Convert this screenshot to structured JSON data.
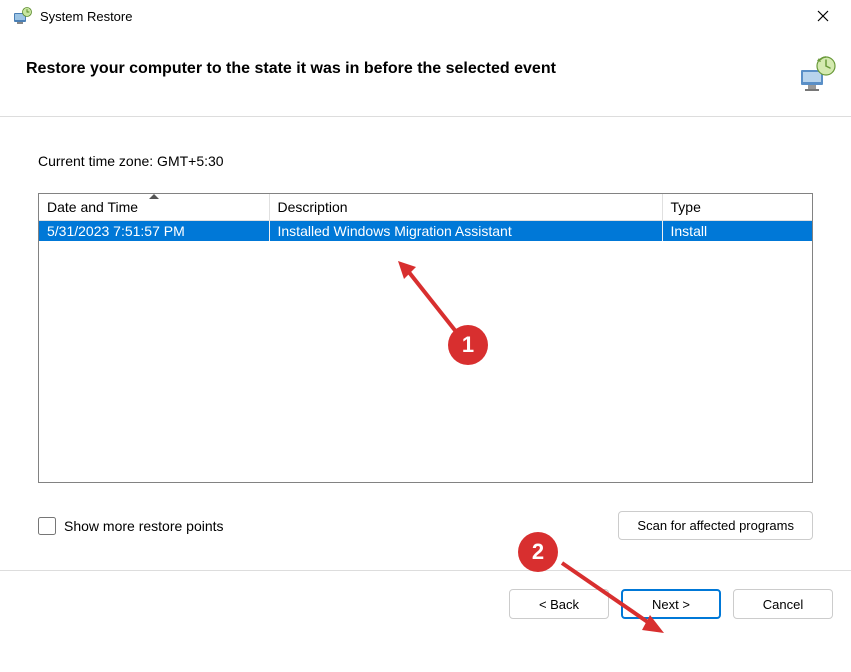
{
  "window": {
    "title": "System Restore"
  },
  "header": {
    "title": "Restore your computer to the state it was in before the selected event"
  },
  "content": {
    "timezone": "Current time zone: GMT+5:30",
    "table": {
      "headers": {
        "date": "Date and Time",
        "desc": "Description",
        "type": "Type"
      },
      "rows": [
        {
          "date": "5/31/2023 7:51:57 PM",
          "desc": "Installed Windows Migration Assistant",
          "type": "Install",
          "selected": true
        }
      ]
    },
    "checkbox_label": "Show more restore points",
    "scan_button": "Scan for affected programs"
  },
  "footer": {
    "back": "< Back",
    "next": "Next >",
    "cancel": "Cancel"
  },
  "annotations": {
    "one": "1",
    "two": "2"
  }
}
